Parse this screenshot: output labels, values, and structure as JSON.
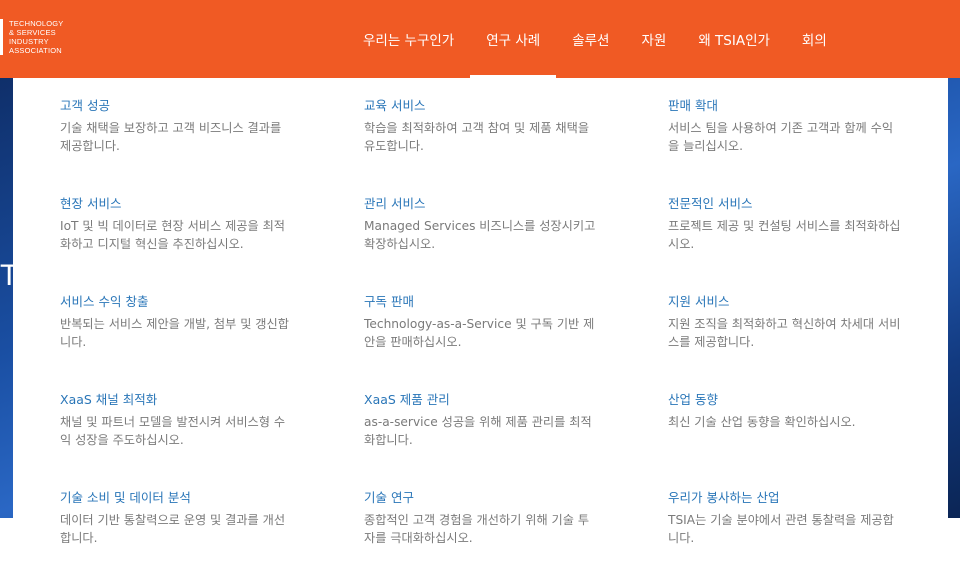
{
  "logo": {
    "lines": [
      "TECHNOLOGY",
      "& SERVICES",
      "INDUSTRY",
      "ASSOCIATION"
    ]
  },
  "hero": {
    "peek_char": "T"
  },
  "nav": {
    "items": [
      {
        "label": "우리는 누구인가"
      },
      {
        "label": "연구 사례"
      },
      {
        "label": "솔루션"
      },
      {
        "label": "자원"
      },
      {
        "label": "왜 TSIA인가"
      },
      {
        "label": "회의"
      }
    ],
    "active_index": 1
  },
  "menu": {
    "items": [
      {
        "title": "고객 성공",
        "desc": "기술 채택을 보장하고 고객 비즈니스 결과를 제공합니다."
      },
      {
        "title": "교육 서비스",
        "desc": "학습을 최적화하여 고객 참여 및 제품 채택을 유도합니다."
      },
      {
        "title": "판매 확대",
        "desc": "서비스 팀을 사용하여 기존 고객과 함께 수익을 늘리십시오."
      },
      {
        "title": "현장 서비스",
        "desc": "IoT 및 빅 데이터로 현장 서비스 제공을 최적화하고 디지털 혁신을 추진하십시오."
      },
      {
        "title": "관리 서비스",
        "desc": "Managed Services 비즈니스를 성장시키고 확장하십시오."
      },
      {
        "title": "전문적인 서비스",
        "desc": "프로젝트 제공 및 컨설팅 서비스를 최적화하십시오."
      },
      {
        "title": "서비스 수익 창출",
        "desc": "반복되는 서비스 제안을 개발, 첨부 및 갱신합니다."
      },
      {
        "title": "구독 판매",
        "desc": "Technology-as-a-Service 및 구독 기반 제안을 판매하십시오."
      },
      {
        "title": "지원 서비스",
        "desc": "지원 조직을 최적화하고 혁신하여 차세대 서비스를 제공합니다."
      },
      {
        "title": "XaaS 채널 최적화",
        "desc": "채널 및 파트너 모델을 발전시켜 서비스형 수익 성장을 주도하십시오."
      },
      {
        "title": "XaaS 제품 관리",
        "desc": "as-a-service 성공을 위해 제품 관리를 최적화합니다."
      },
      {
        "title": "산업 동향",
        "desc": "최신 기술 산업 동향을 확인하십시오."
      },
      {
        "title": "기술 소비 및 데이터 분석",
        "desc": "데이터 기반 통찰력으로 운영 및 결과를 개선합니다."
      },
      {
        "title": "기술 연구",
        "desc": "종합적인 고객 경험을 개선하기 위해 기술 투자를 극대화하십시오."
      },
      {
        "title": "우리가 봉사하는 산업",
        "desc": "TSIA는 기술 분야에서 관련 통찰력을 제공합니다."
      }
    ]
  },
  "colors": {
    "brand_orange": "#f05a24",
    "link_blue": "#2a76b8",
    "desc_gray": "#7a7a7a",
    "hero_blue": "#1a4fa3"
  }
}
